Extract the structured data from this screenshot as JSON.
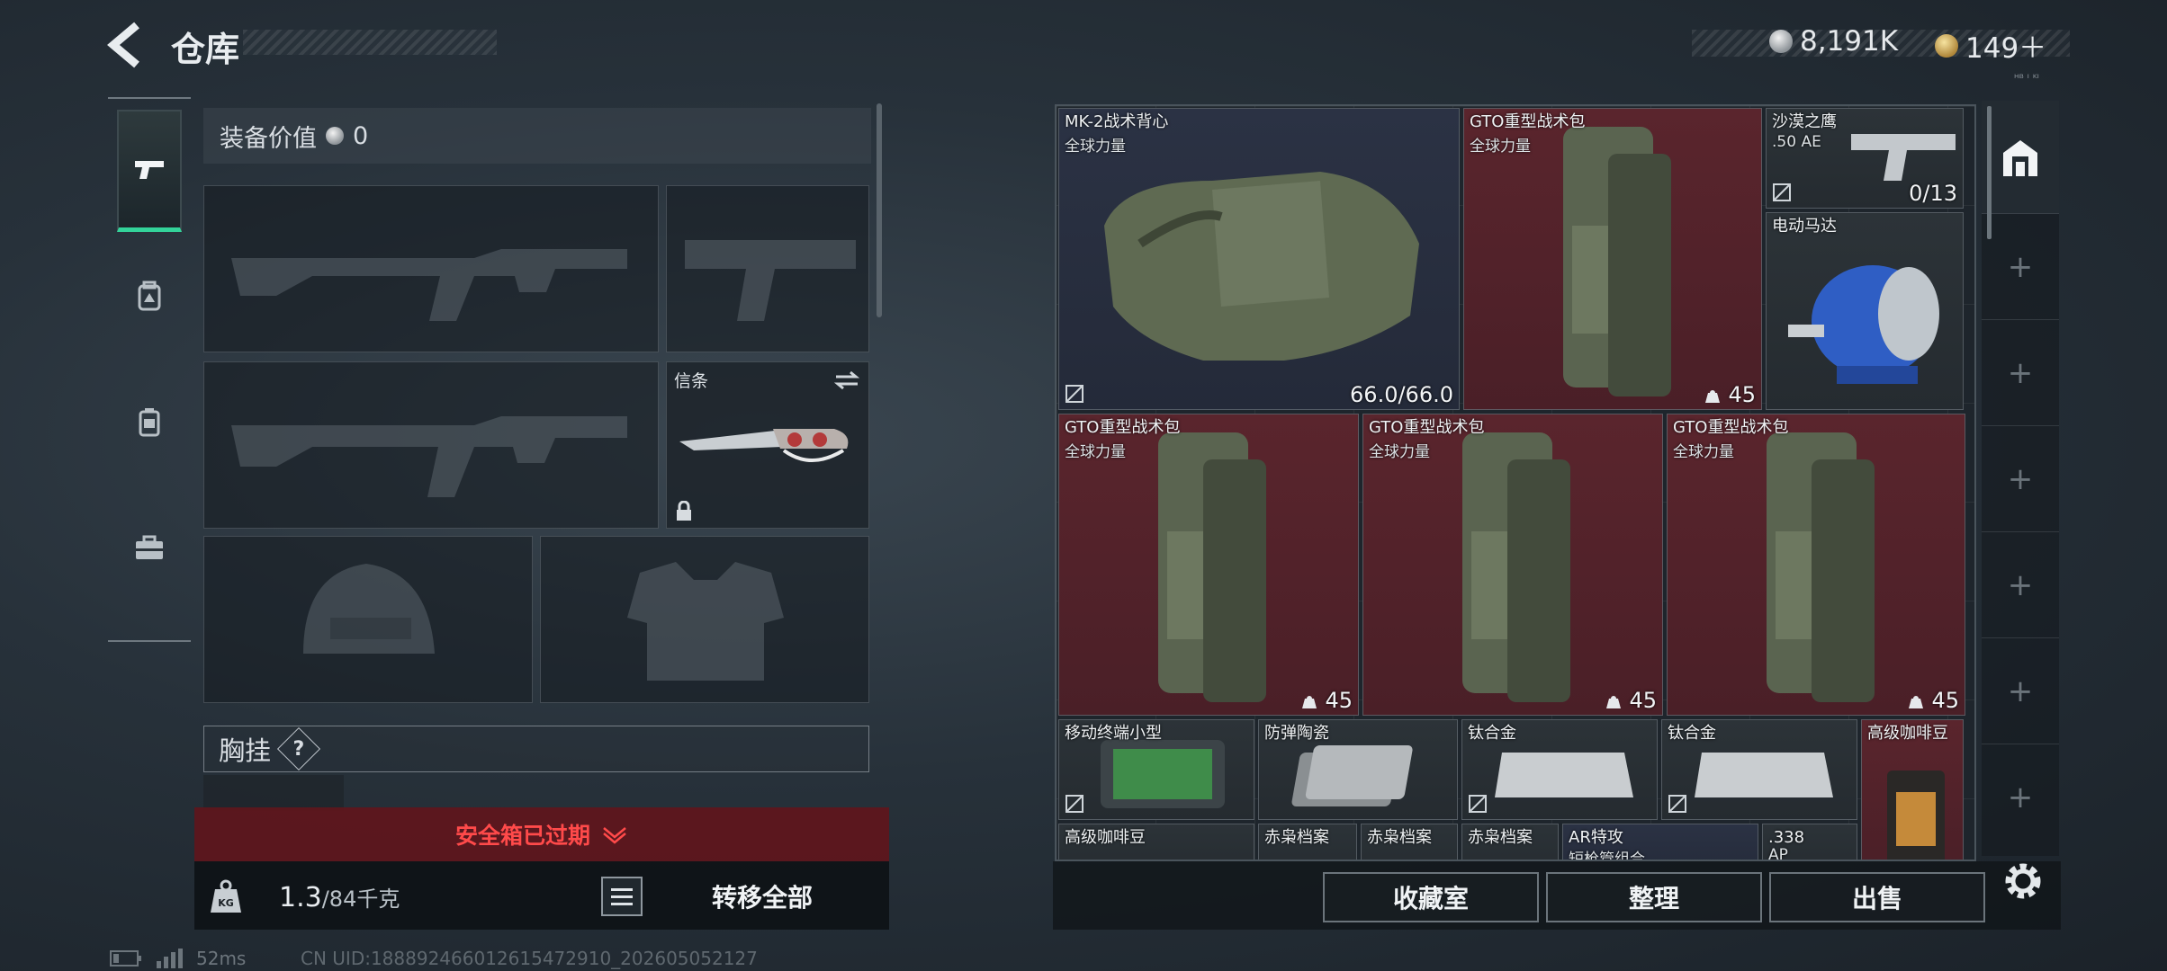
{
  "header": {
    "title": "仓库",
    "currency_silver": "8,191K",
    "currency_gold": "149＋",
    "tiny_label": "ᴴᴮ ᴵ ᴷᴵ"
  },
  "left": {
    "equip_value_label": "装备价值",
    "equip_value": "0",
    "melee_slot_label": "信条",
    "chest_label": "胸挂",
    "chest_help": "?",
    "expired_text": "安全箱已过期",
    "weight_current": "1.3",
    "weight_max": "/84千克",
    "transfer_all": "转移全部",
    "kg_label": "KG"
  },
  "status": {
    "ping": "52ms",
    "uid": "CN UID:1888924660126154729​10_202605052127"
  },
  "items": {
    "vest": {
      "name": "MK-2战术背心",
      "sub": "全球力量",
      "durability": "66.0/66.0"
    },
    "bag1": {
      "name": "GTO重型战术包",
      "sub": "全球力量",
      "count": "45"
    },
    "pistol": {
      "name": "沙漠之鹰",
      "sub": ".50 AE",
      "ammo": "0/13"
    },
    "motor": {
      "name": "电动马达"
    },
    "bag2": {
      "name": "GTO重型战术包",
      "sub": "全球力量",
      "count": "45"
    },
    "bag3": {
      "name": "GTO重型战术包",
      "sub": "全球力量",
      "count": "45"
    },
    "bag4": {
      "name": "GTO重型战术包",
      "sub": "全球力量",
      "count": "45"
    },
    "terminal": {
      "name": "移动终端小型"
    },
    "ceramic": {
      "name": "防弹陶瓷"
    },
    "titanium1": {
      "name": "钛合金"
    },
    "titanium2": {
      "name": "钛合金"
    },
    "coffee1": {
      "name": "高级咖啡豆"
    },
    "coffee2": {
      "name": "高级咖啡豆"
    },
    "owl1": {
      "name": "赤枭档案"
    },
    "owl2": {
      "name": "赤枭档案"
    },
    "owl3": {
      "name": "赤枭档案"
    },
    "ar_kit": {
      "name": "AR特攻",
      "sub": "短枪管组合"
    },
    "ammo338": {
      "name": ".338",
      "sub": "AP"
    }
  },
  "buttons": {
    "collection": "收藏室",
    "organize": "整理",
    "sell": "出售"
  },
  "side_tabs": [
    "+",
    "+",
    "+",
    "+",
    "+",
    "+",
    "+"
  ],
  "colors": {
    "accent_green": "#33d39a",
    "expired_red": "#ff4a4a",
    "rare_red_bg": "#5a252d",
    "blue_bg": "#2b3244"
  }
}
